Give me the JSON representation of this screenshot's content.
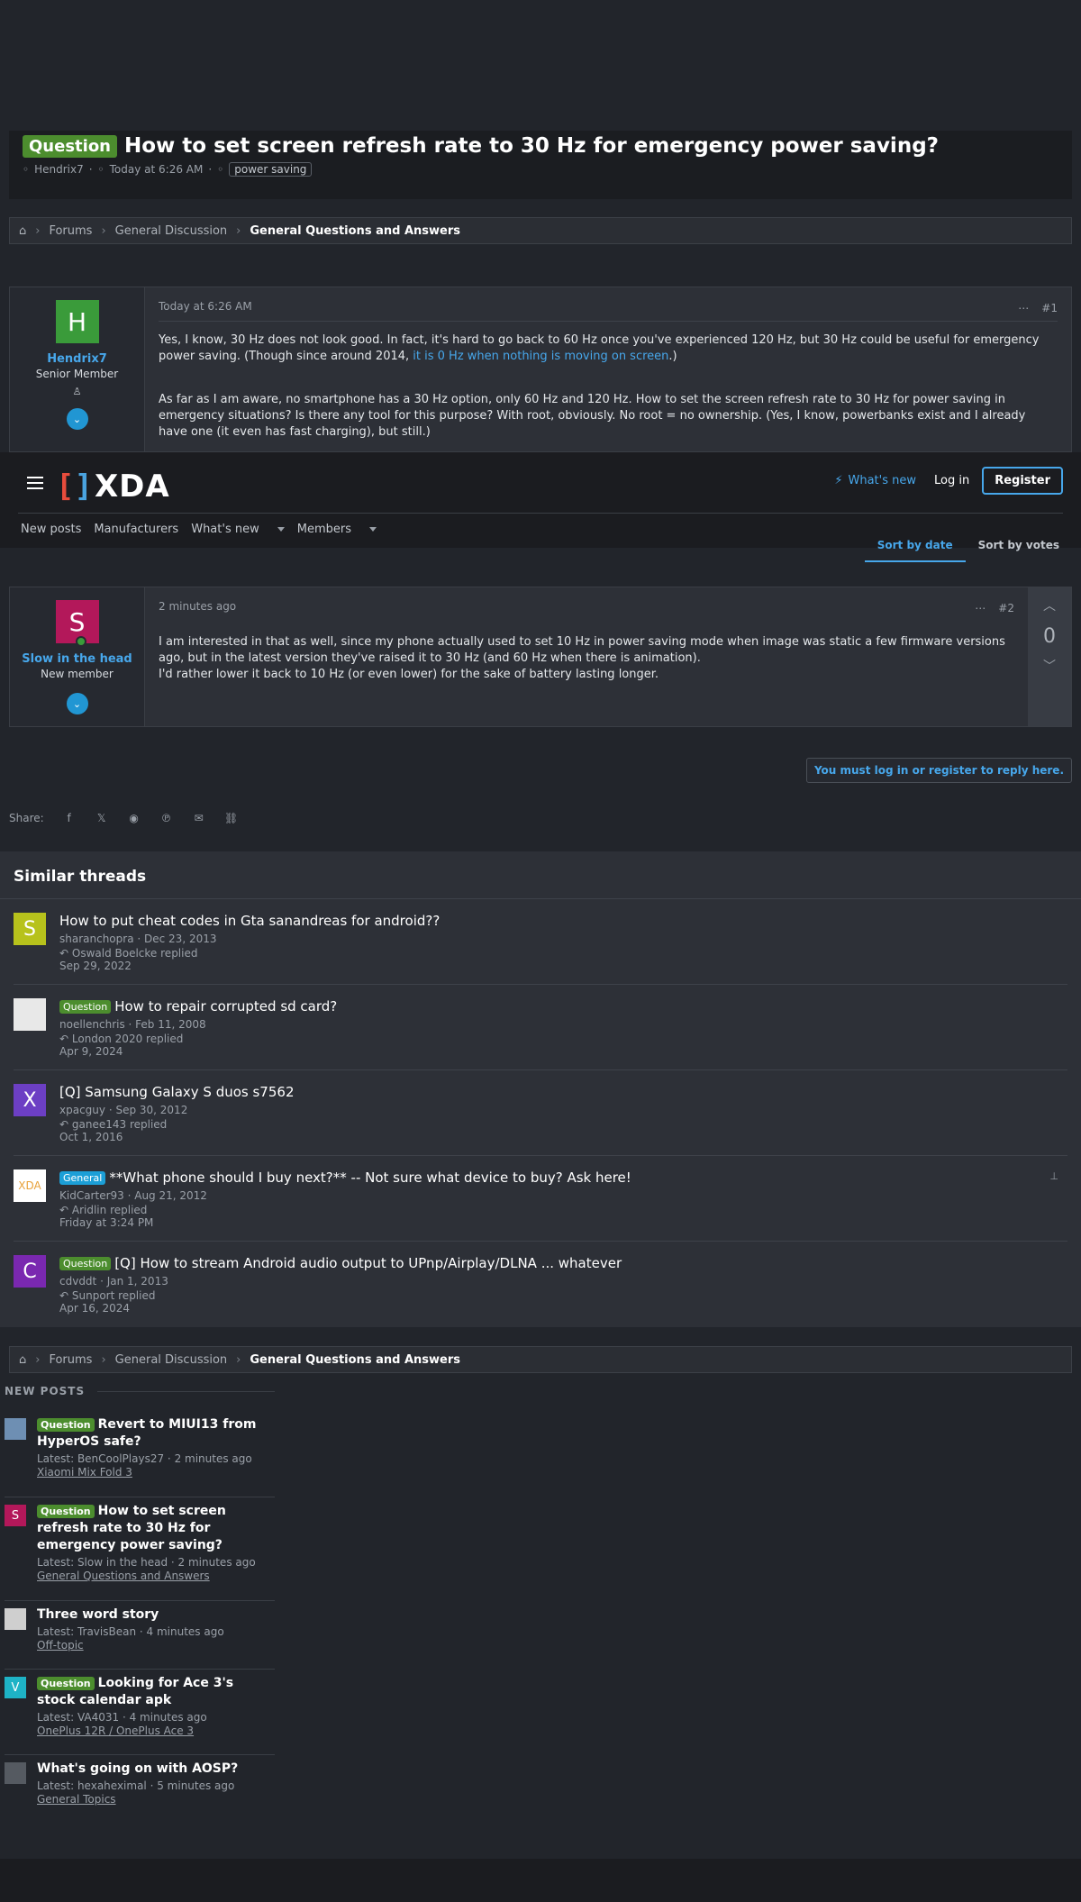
{
  "thread": {
    "prefix": "Question",
    "title": "How to set screen refresh rate to 30 Hz for emergency power saving?",
    "author": "Hendrix7",
    "date": "Today at 6:26 AM",
    "tag": "power saving"
  },
  "breadcrumb": {
    "items": [
      "Forums",
      "General Discussion"
    ],
    "current": "General Questions and Answers"
  },
  "post1": {
    "avatar_letter": "H",
    "avatar_color": "#3a9b3a",
    "username": "Hendrix7",
    "user_title": "Senior Member",
    "date": "Today at 6:26 AM",
    "number": "#1",
    "para1_before": "Yes, I know, 30 Hz does not look good. In fact, it's hard to go back to 60 Hz once you've experienced 120 Hz, but 30 Hz could be useful for emergency power saving. (Though since around 2014,",
    "para1_link": "it is 0 Hz when nothing is moving on screen",
    "para1_after": ".)",
    "para2": "As far as I am aware, no smartphone has a 30 Hz option, only 60 Hz and 120 Hz. How to set the screen refresh rate to 30 Hz for power saving in emergency situations? Is there any tool for this purpose? With root, obviously. No root = no ownership. (Yes, I know, powerbanks exist and I already have one (it even has fast charging), but still.)"
  },
  "header": {
    "logo_text": "XDA",
    "whats_new": "What's new",
    "login": "Log in",
    "register": "Register",
    "nav": [
      "New posts",
      "Manufacturers",
      "What's new",
      "Members"
    ]
  },
  "sort": {
    "by_date": "Sort by date",
    "by_votes": "Sort by votes"
  },
  "post2": {
    "avatar_letter": "S",
    "avatar_color": "#b3185a",
    "username": "Slow in the head",
    "user_title": "New member",
    "date": "2 minutes ago",
    "number": "#2",
    "votes": "0",
    "body_line1": "I am interested in that as well, since my phone actually used to set 10 Hz in power saving mode when image was static a few firmware versions ago, but in the latest version they've raised it to 30 Hz (and 60 Hz when there is animation).",
    "body_line2": "I'd rather lower it back to 10 Hz (or even lower) for the sake of battery lasting longer."
  },
  "reply_note": "You must log in or register to reply here.",
  "share_label": "Share:",
  "similar": {
    "heading": "Similar threads",
    "threads": [
      {
        "letter": "S",
        "color": "#b7c21c",
        "prefix": "",
        "title": "How to put cheat codes in Gta sanandreas for android??",
        "author": "sharanchopra",
        "date": "Dec 23, 2013",
        "replier": "Oswald Boelcke",
        "replied": "replied",
        "last": "Sep 29, 2022"
      },
      {
        "letter": "",
        "color": "#e8e8e8",
        "prefix": "Question",
        "title": "How to repair corrupted sd card?",
        "author": "noellenchris",
        "date": "Feb 11, 2008",
        "replier": "London 2020",
        "replied": "replied",
        "last": "Apr 9, 2024"
      },
      {
        "letter": "X",
        "color": "#6c3fc4",
        "prefix": "",
        "title": "[Q] Samsung Galaxy S duos s7562",
        "author": "xpacguy",
        "date": "Sep 30, 2012",
        "replier": "ganee143",
        "replied": "replied",
        "last": "Oct 1, 2016"
      },
      {
        "letter": "XDA",
        "color": "#ffffff",
        "prefix": "General",
        "title": "**What phone should I buy next?** -- Not sure what device to buy? Ask here!",
        "author": "KidCarter93",
        "date": "Aug 21, 2012",
        "replier": "Aridlin",
        "replied": "replied",
        "last": "Friday at 3:24 PM"
      },
      {
        "letter": "C",
        "color": "#7a28b0",
        "prefix": "Question",
        "title": "[Q] How to stream Android audio output to UPnp/Airplay/DLNA ... whatever",
        "author": "cdvddt",
        "date": "Jan 1, 2013",
        "replier": "Sunport",
        "replied": "replied",
        "last": "Apr 16, 2024"
      }
    ]
  },
  "new_posts": {
    "heading": "NEW POSTS",
    "items": [
      {
        "letter": "",
        "color": "#6e8fb3",
        "prefix": "Question",
        "title": "Revert to MIUI13 from HyperOS safe?",
        "latest": "Latest: BenCoolPlays27",
        "time": "2 minutes ago",
        "forum": "Xiaomi Mix Fold 3"
      },
      {
        "letter": "S",
        "color": "#b3185a",
        "prefix": "Question",
        "title": "How to set screen refresh rate to 30 Hz for emergency power saving?",
        "latest": "Latest: Slow in the head",
        "time": "2 minutes ago",
        "forum": "General Questions and Answers"
      },
      {
        "letter": "",
        "color": "#cfcfcf",
        "prefix": "",
        "title": "Three word story",
        "latest": "Latest: TravisBean",
        "time": "4 minutes ago",
        "forum": "Off-topic"
      },
      {
        "letter": "V",
        "color": "#1eb3c6",
        "prefix": "Question",
        "title": "Looking for Ace 3's stock calendar apk",
        "latest": "Latest: VA4031",
        "time": "4 minutes ago",
        "forum": "OnePlus 12R / OnePlus Ace 3"
      },
      {
        "letter": "",
        "color": "#555a61",
        "prefix": "",
        "title": "What's going on with AOSP?",
        "latest": "Latest: hexaheximal",
        "time": "5 minutes ago",
        "forum": "General Topics"
      }
    ]
  }
}
